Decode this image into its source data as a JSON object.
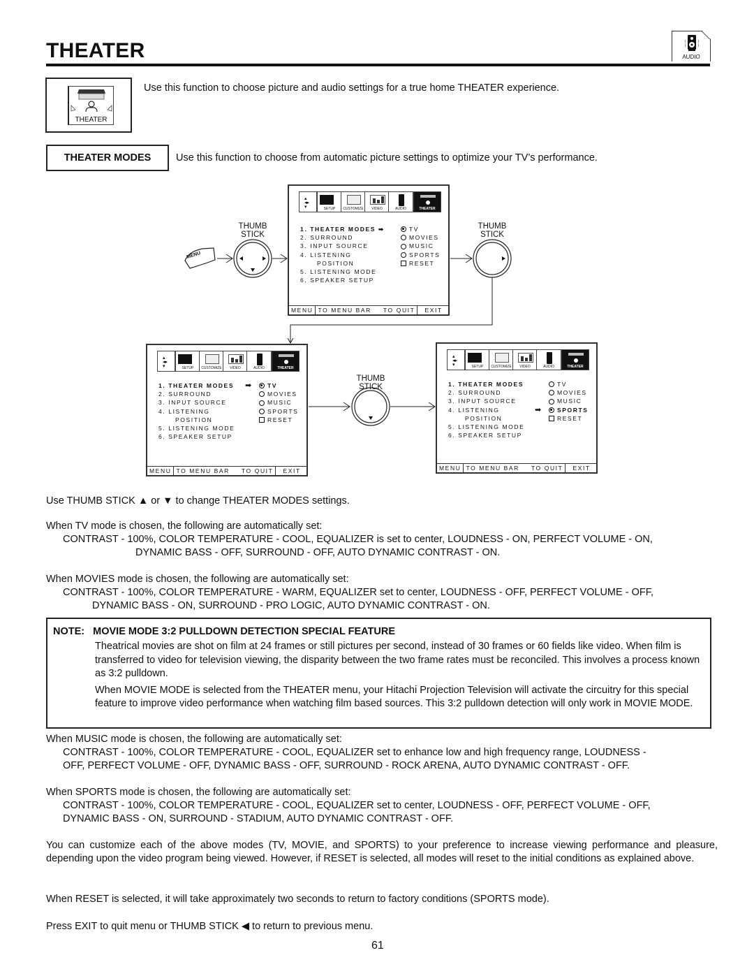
{
  "header": {
    "title": "THEATER",
    "corner_badge": {
      "icon": "speaker-icon",
      "label": "AUDIO"
    }
  },
  "intro": {
    "icon": {
      "name": "theater-icon",
      "label": "THEATER"
    },
    "text": "Use this function to choose picture and audio settings for a true home THEATER experience."
  },
  "theater_modes": {
    "label": "THEATER MODES",
    "description": "Use this function to choose from automatic picture settings to optimize your TV’s performance."
  },
  "diagram": {
    "menu_button_label": "MENU",
    "thumb_stick_label": [
      "THUMB",
      "STICK"
    ],
    "tabs": [
      "SETUP",
      "CUSTOMIZE",
      "VIDEO",
      "AUDIO",
      "THEATER"
    ],
    "menu_items": [
      "1. THEATER MODES",
      "2. SURROUND",
      "3. INPUT SOURCE",
      "4. LISTENING",
      "POSITION",
      "5. LISTENING MODE",
      "6. SPEAKER SETUP"
    ],
    "options": [
      "TV",
      "MOVIES",
      "MUSIC",
      "SPORTS",
      "RESET"
    ],
    "footer": [
      "MENU",
      "TO MENU BAR",
      "TO QUIT",
      "EXIT"
    ],
    "screens": [
      {
        "id": "top",
        "selected_option": "TV",
        "arrow_location": "menu-item"
      },
      {
        "id": "bottom-left",
        "selected_option": "TV",
        "arrow_location": "option"
      },
      {
        "id": "bottom-right",
        "selected_option": "SPORTS",
        "arrow_location": "option"
      }
    ]
  },
  "body": {
    "usage": "Use THUMB STICK ▲ or ▼ to change THEATER MODES settings.",
    "tv_intro": "When TV mode is chosen, the following are automatically set:",
    "tv_line1": "CONTRAST - 100%, COLOR TEMPERATURE - COOL, EQUALIZER is set to center, LOUDNESS - ON, PERFECT VOLUME - ON,",
    "tv_line2": "DYNAMIC BASS - OFF, SURROUND  - OFF, AUTO DYNAMIC CONTRAST - ON.",
    "movies_intro": "When MOVIES mode is chosen, the following are automatically set:",
    "movies_line1": "CONTRAST - 100%, COLOR TEMPERATURE - WARM, EQUALIZER set to center, LOUDNESS - OFF, PERFECT VOLUME - OFF,",
    "movies_line2": "DYNAMIC BASS - ON, SURROUND - PRO LOGIC, AUTO DYNAMIC CONTRAST - ON.",
    "note": {
      "prefix": "NOTE:",
      "title": "MOVIE MODE 3:2 PULLDOWN DETECTION SPECIAL FEATURE",
      "p1": "Theatrical movies are shot on film at 24 frames or still pictures per second, instead of 30 frames or 60 fields like video.  When film is transferred to video for television viewing, the disparity between the two frame rates must be reconciled.  This involves a process known as 3:2 pulldown.",
      "p2": "When MOVIE MODE is selected from the THEATER menu, your Hitachi Projection Television will activate the circuitry for this special feature to improve video performance when watching film based sources.  This 3:2 pulldown detection will only work in MOVIE MODE."
    },
    "music_intro": "When MUSIC mode is chosen, the following are automatically set:",
    "music_line1": "CONTRAST - 100%, COLOR TEMPERATURE - COOL, EQUALIZER set to enhance low and high frequency range, LOUDNESS -",
    "music_line2": "OFF, PERFECT VOLUME - OFF, DYNAMIC BASS - OFF, SURROUND - ROCK ARENA, AUTO DYNAMIC CONTRAST - OFF.",
    "sports_intro": "When SPORTS mode is chosen, the following are automatically set:",
    "sports_line1": "CONTRAST - 100%, COLOR TEMPERATURE - COOL, EQUALIZER set to center, LOUDNESS - OFF, PERFECT VOLUME - OFF,",
    "sports_line2": "DYNAMIC BASS - ON, SURROUND - STADIUM, AUTO DYNAMIC CONTRAST - OFF.",
    "customize": "You can customize each of the above modes (TV, MOVIE, and SPORTS) to your preference to increase viewing performance and pleasure, depending upon the video program being viewed. However, if RESET is selected, all modes will reset to the initial conditions as explained above.",
    "reset_info": "When RESET is selected, it will take approximately two seconds to return to factory conditions (SPORTS mode).",
    "exit_info": "Press EXIT to quit menu or THUMB STICK ◀ to return to previous menu."
  },
  "page_number": "61"
}
